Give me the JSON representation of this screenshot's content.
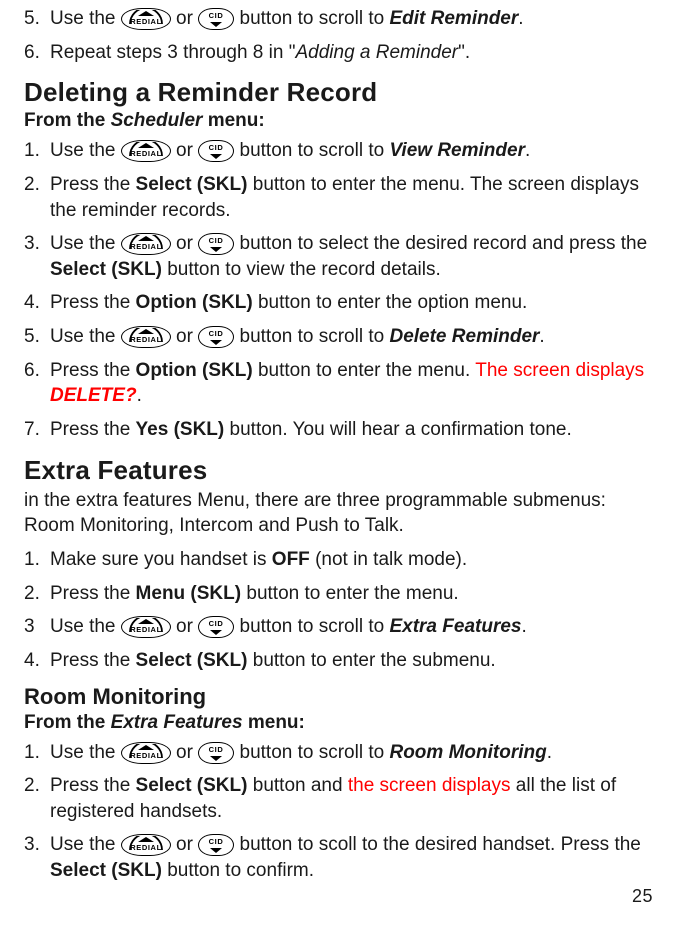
{
  "icons": {
    "redial_label": "REDIAL",
    "cid_label": "CID"
  },
  "top_steps": [
    {
      "n": "5.",
      "parts": [
        {
          "t": "Use the "
        },
        {
          "icon": "redial"
        },
        {
          "t": " or "
        },
        {
          "icon": "cid"
        },
        {
          "t": " button to scroll to "
        },
        {
          "t": "Edit Reminder",
          "cls": "bi"
        },
        {
          "t": "."
        }
      ]
    },
    {
      "n": "6.",
      "parts": [
        {
          "t": "Repeat steps 3 through 8 in \""
        },
        {
          "t": "Adding a Reminder",
          "cls": "i"
        },
        {
          "t": "\"."
        }
      ]
    }
  ],
  "deleting": {
    "heading": "Deleting a Reminder Record",
    "menu_line_prefix": "From the ",
    "menu_line_em": "Scheduler",
    "menu_line_suffix": " menu:",
    "steps": [
      {
        "n": "1.",
        "parts": [
          {
            "t": "Use the "
          },
          {
            "icon": "redial"
          },
          {
            "t": " or "
          },
          {
            "icon": "cid"
          },
          {
            "t": " button to scroll to "
          },
          {
            "t": "View Reminder",
            "cls": "bi"
          },
          {
            "t": "."
          }
        ]
      },
      {
        "n": "2.",
        "parts": [
          {
            "t": "Press the "
          },
          {
            "t": "Select (SKL)",
            "cls": "b"
          },
          {
            "t": " button to enter the menu. The screen displays the reminder records."
          }
        ]
      },
      {
        "n": "3.",
        "parts": [
          {
            "t": "Use the "
          },
          {
            "icon": "redial"
          },
          {
            "t": " or "
          },
          {
            "icon": "cid"
          },
          {
            "t": " button to select the desired record and press the "
          },
          {
            "t": "Select (SKL)",
            "cls": "b"
          },
          {
            "t": " button to view the record details."
          }
        ]
      },
      {
        "n": "4.",
        "parts": [
          {
            "t": "Press the "
          },
          {
            "t": "Option (SKL)",
            "cls": "b"
          },
          {
            "t": " button to enter the option menu."
          }
        ]
      },
      {
        "n": "5.",
        "parts": [
          {
            "t": "Use the "
          },
          {
            "icon": "redial"
          },
          {
            "t": " or "
          },
          {
            "icon": "cid"
          },
          {
            "t": " button to scroll to "
          },
          {
            "t": "Delete Reminder",
            "cls": "bi"
          },
          {
            "t": "."
          }
        ]
      },
      {
        "n": "6.",
        "parts": [
          {
            "t": "Press the "
          },
          {
            "t": "Option (SKL)",
            "cls": "b"
          },
          {
            "t": " button to enter the menu. "
          },
          {
            "t": "The screen displays ",
            "cls": "red"
          },
          {
            "t": "DELETE?",
            "cls": "red bi"
          },
          {
            "t": "."
          }
        ]
      },
      {
        "n": "7.",
        "parts": [
          {
            "t": "Press the "
          },
          {
            "t": "Yes (SKL)",
            "cls": "b"
          },
          {
            "t": " button. You will hear a confirmation tone."
          }
        ]
      }
    ]
  },
  "extra": {
    "heading": "Extra Features",
    "intro": "in the extra features Menu, there are three programmable submenus: Room Monitoring, Intercom and Push to Talk.",
    "steps": [
      {
        "n": "1.",
        "parts": [
          {
            "t": "Make sure you handset is "
          },
          {
            "t": "OFF",
            "cls": "b"
          },
          {
            "t": " (not in talk mode)."
          }
        ]
      },
      {
        "n": "2.",
        "parts": [
          {
            "t": "Press the "
          },
          {
            "t": "Menu (SKL)",
            "cls": "b"
          },
          {
            "t": " button to enter the menu."
          }
        ]
      },
      {
        "n": "3",
        "parts": [
          {
            "t": "Use the "
          },
          {
            "icon": "redial"
          },
          {
            "t": " or "
          },
          {
            "icon": "cid"
          },
          {
            "t": " button to scroll to "
          },
          {
            "t": "Extra Features",
            "cls": "bi"
          },
          {
            "t": "."
          }
        ]
      },
      {
        "n": "4.",
        "parts": [
          {
            "t": "Press the "
          },
          {
            "t": "Select (SKL)",
            "cls": "b"
          },
          {
            "t": " button to enter the submenu."
          }
        ]
      }
    ]
  },
  "room": {
    "heading": "Room Monitoring",
    "menu_line_prefix": "From the ",
    "menu_line_em": "Extra Features",
    "menu_line_suffix": " menu:",
    "steps": [
      {
        "n": "1.",
        "parts": [
          {
            "t": "Use the "
          },
          {
            "icon": "redial"
          },
          {
            "t": " or "
          },
          {
            "icon": "cid"
          },
          {
            "t": " button to scroll to "
          },
          {
            "t": "Room Monitoring",
            "cls": "bi"
          },
          {
            "t": "."
          }
        ]
      },
      {
        "n": "2.",
        "parts": [
          {
            "t": "Press the "
          },
          {
            "t": "Select (SKL)",
            "cls": "b"
          },
          {
            "t": " button and "
          },
          {
            "t": "the screen displays",
            "cls": "red"
          },
          {
            "t": " all the list of registered handsets."
          }
        ]
      },
      {
        "n": "3.",
        "parts": [
          {
            "t": "Use the "
          },
          {
            "icon": "redial"
          },
          {
            "t": " or "
          },
          {
            "icon": "cid"
          },
          {
            "t": " button to scoll to the desired handset. Press the "
          },
          {
            "t": "Select (SKL)",
            "cls": "b"
          },
          {
            "t": " button to confirm."
          }
        ]
      }
    ]
  },
  "page_number": "25"
}
